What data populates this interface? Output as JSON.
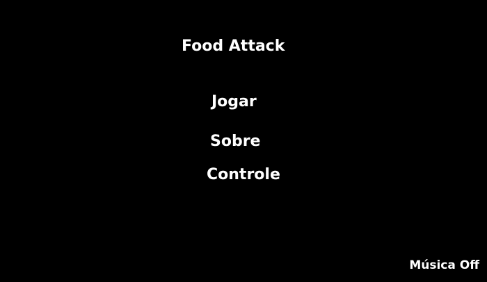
{
  "game": {
    "title": "Food Attack"
  },
  "menu": {
    "items": [
      {
        "label": "Jogar"
      },
      {
        "label": "Sobre"
      },
      {
        "label": "Controle"
      }
    ]
  },
  "settings": {
    "music_toggle_label": "Música Off"
  },
  "colors": {
    "background": "#000000",
    "text": "#ffffff"
  }
}
